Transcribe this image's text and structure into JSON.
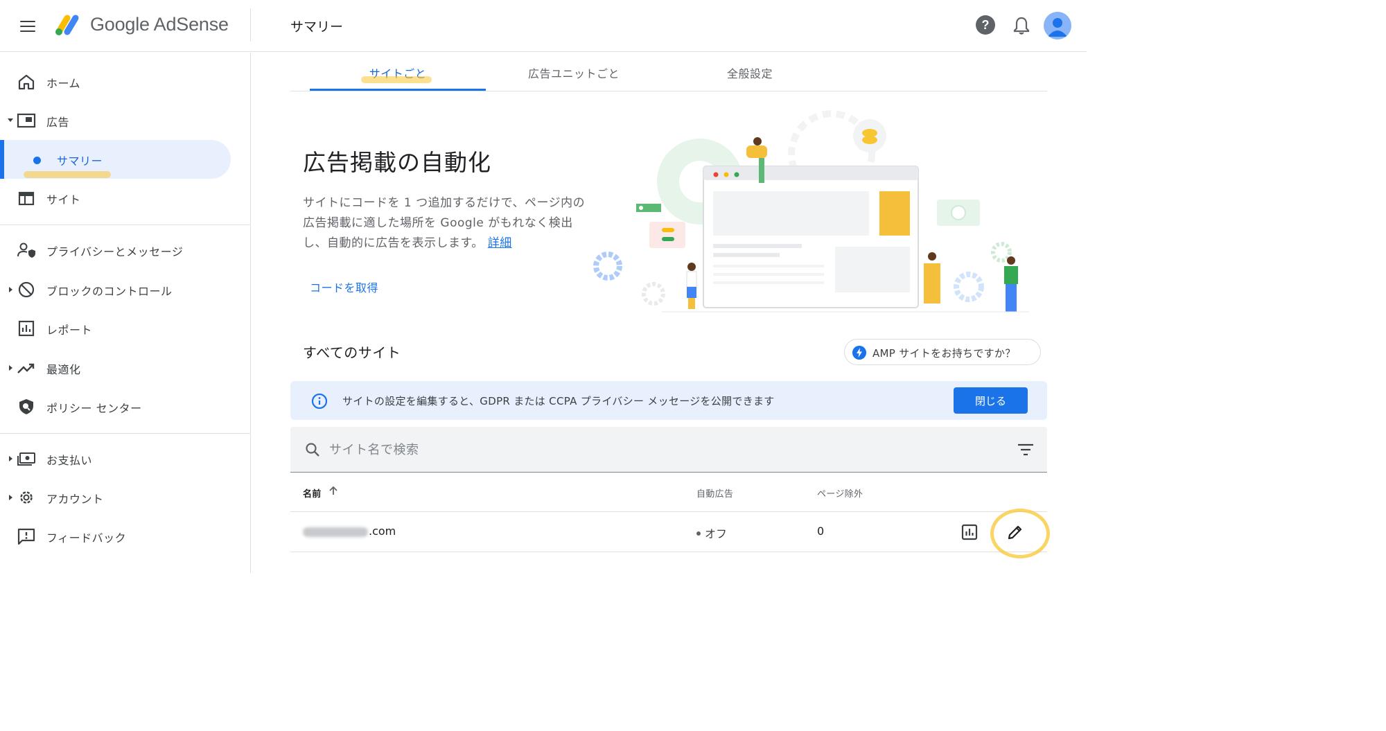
{
  "header": {
    "product_name": "Google AdSense",
    "page_title": "サマリー"
  },
  "colors": {
    "accent": "#1a73e8",
    "highlight": "#f9c633",
    "banner_bg": "#e8f0fe"
  },
  "sidebar": {
    "items": [
      {
        "label": "ホーム",
        "icon": "home-icon"
      },
      {
        "label": "広告",
        "icon": "ads-icon"
      },
      {
        "label": "サマリー",
        "icon": "dot-icon"
      },
      {
        "label": "サイト",
        "icon": "site-icon"
      },
      {
        "label": "プライバシーとメッセージ",
        "icon": "person-shield-icon"
      },
      {
        "label": "ブロックのコントロール",
        "icon": "block-icon"
      },
      {
        "label": "レポート",
        "icon": "report-icon"
      },
      {
        "label": "最適化",
        "icon": "trending-up-icon"
      },
      {
        "label": "ポリシー センター",
        "icon": "policy-shield-icon"
      },
      {
        "label": "お支払い",
        "icon": "payments-icon"
      },
      {
        "label": "アカウント",
        "icon": "gear-icon"
      },
      {
        "label": "フィードバック",
        "icon": "feedback-icon"
      }
    ]
  },
  "tabs": [
    {
      "label": "サイトごと"
    },
    {
      "label": "広告ユニットごと"
    },
    {
      "label": "全般設定"
    }
  ],
  "hero": {
    "title": "広告掲載の自動化",
    "description": "サイトにコードを 1 つ追加するだけで、ページ内の広告掲載に適した場所を Google がもれなく検出し、自動的に広告を表示します。",
    "link": "詳細",
    "get_code": "コードを取得"
  },
  "sites_section": {
    "title": "すべてのサイト",
    "amp_chip": "AMP サイトをお持ちですか？"
  },
  "banner": {
    "text": "サイトの設定を編集すると、GDPR または CCPA プライバシー メッセージを公開できます",
    "close_label": "閉じる"
  },
  "search": {
    "placeholder": "サイト名で検索"
  },
  "table": {
    "columns": [
      "名前",
      "自動広告",
      "ページ除外"
    ],
    "rows": [
      {
        "domain": ".com",
        "auto_ads": "オフ",
        "page_exclusions": "0"
      }
    ]
  }
}
